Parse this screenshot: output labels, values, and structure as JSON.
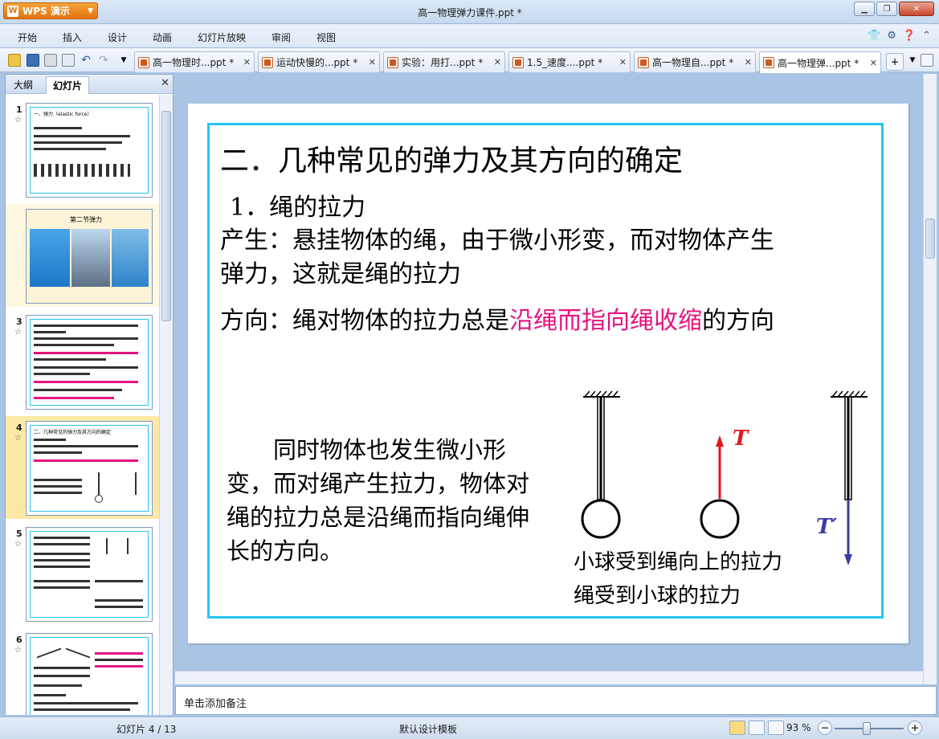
{
  "app": {
    "logo_label": "WPS 演示",
    "window_title": "高一物理弹力课件.ppt *"
  },
  "menu": {
    "items": [
      "开始",
      "插入",
      "设计",
      "动画",
      "幻灯片放映",
      "审阅",
      "视图"
    ]
  },
  "tabs": [
    {
      "label": "高一物理时...ppt *"
    },
    {
      "label": "运动快慢的...ppt *"
    },
    {
      "label": "实验：用打...ppt *"
    },
    {
      "label": "1.5_速度....ppt *"
    },
    {
      "label": "高一物理自...ppt *"
    },
    {
      "label": "高一物理弹...ppt *"
    }
  ],
  "left_panel": {
    "tab_outline": "大纲",
    "tab_slides": "幻灯片",
    "slides": [
      {
        "num": "1",
        "title": "一、弹力（elastic force）"
      },
      {
        "num": "",
        "title": "第二节弹力"
      },
      {
        "num": "3",
        "title": ""
      },
      {
        "num": "4",
        "title": "二、几种常见的弹力及其方向的确定"
      },
      {
        "num": "5",
        "title": ""
      },
      {
        "num": "6",
        "title": ""
      }
    ]
  },
  "slide": {
    "title": "二．几种常见的弹力及其方向的确定",
    "subtitle": "1．绳的拉力",
    "para1_line1": "产生：悬挂物体的绳，由于微小形变，而对物体产生",
    "para1_line2": "弹力，这就是绳的拉力",
    "para2_prefix": "方向：绳对物体的拉力总是",
    "para2_highlight": "沿绳而指向绳收缩",
    "para2_suffix": "的方向",
    "side_text": "同时物体也发生微小形变，而对绳产生拉力，物体对绳的拉力总是沿绳而指向绳伸长的方向。",
    "label_T": "T",
    "label_T_prime": "T′",
    "caption1": "小球受到绳向上的拉力",
    "caption2": "绳受到小球的拉力",
    "colors": {
      "border": "#27c3f1",
      "highlight": "#e5137f",
      "arrow_T": "#e3141c",
      "arrow_T_prime": "#3a3aa0"
    }
  },
  "notes": {
    "placeholder": "单击添加备注"
  },
  "status": {
    "slide_indicator": "幻灯片 4 / 13",
    "template": "默认设计模板",
    "zoom": "93 %"
  }
}
